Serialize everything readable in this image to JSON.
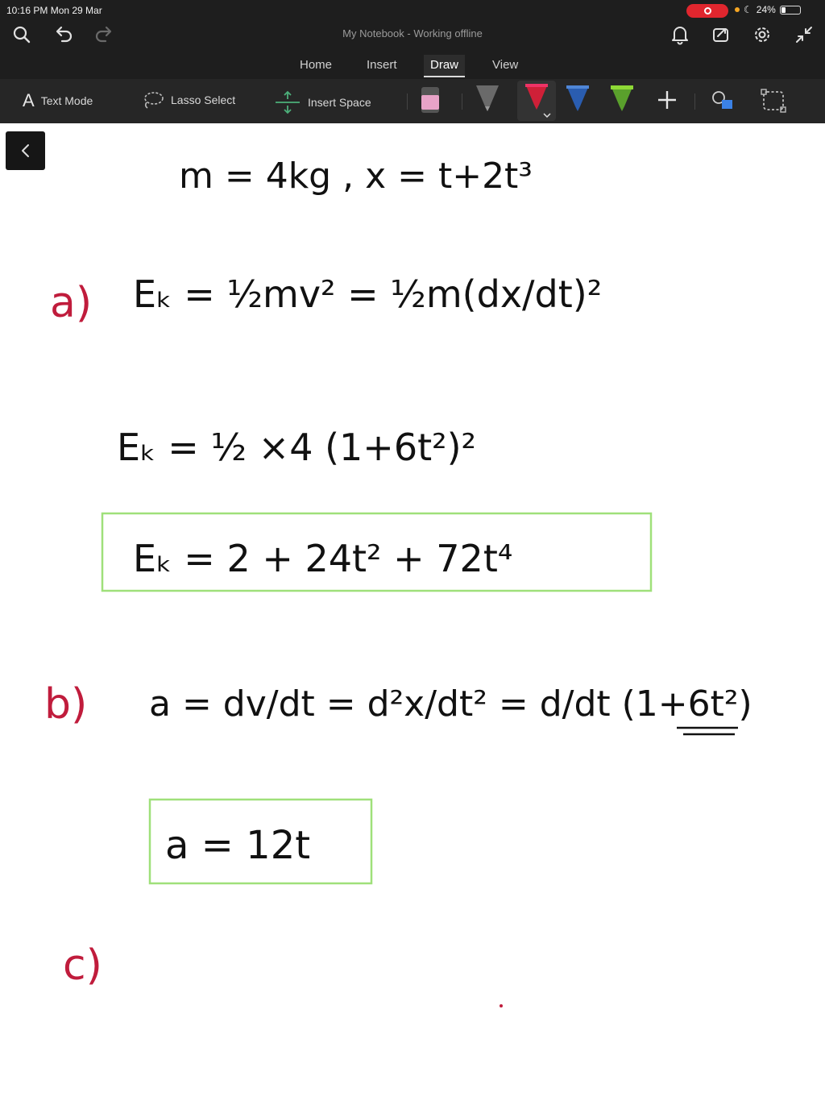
{
  "status_bar": {
    "time": "10:16 PM   Mon 29 Mar",
    "battery": "24%",
    "battery_level": 0.24
  },
  "header": {
    "title": "My Notebook - Working offline"
  },
  "tabs": [
    {
      "label": "Home"
    },
    {
      "label": "Insert"
    },
    {
      "label": "Draw",
      "active": true
    },
    {
      "label": "View"
    }
  ],
  "toolbar": {
    "text_mode": "Text Mode",
    "lasso_select": "Lasso Select",
    "insert_space": "Insert Space"
  },
  "pens": [
    {
      "color": "#9a9a9a"
    },
    {
      "color": "#cf2038"
    },
    {
      "color": "#2a5db0"
    },
    {
      "color": "#8ed936"
    }
  ],
  "colors": {
    "ink": "#111111",
    "label_ink": "#c01c3c",
    "box": "#9fe07a",
    "highlighter": "#e8a3c8"
  },
  "notes": {
    "given": "m = 4kg , x = t+2t³",
    "part_a_label": "a)",
    "part_a_line1": "Eₖ = ½mv² = ½m(dx/dt)²",
    "part_a_line2": "Eₖ = ½ ×4 (1+6t²)²",
    "part_a_answer": "Eₖ = 2 + 24t² + 72t⁴",
    "part_b_label": "b)",
    "part_b_line1": "a = dv/dt = d²x/dt² = d/dt (1+6t²)",
    "part_b_answer": "a = 12t",
    "part_c_label": "c)"
  }
}
